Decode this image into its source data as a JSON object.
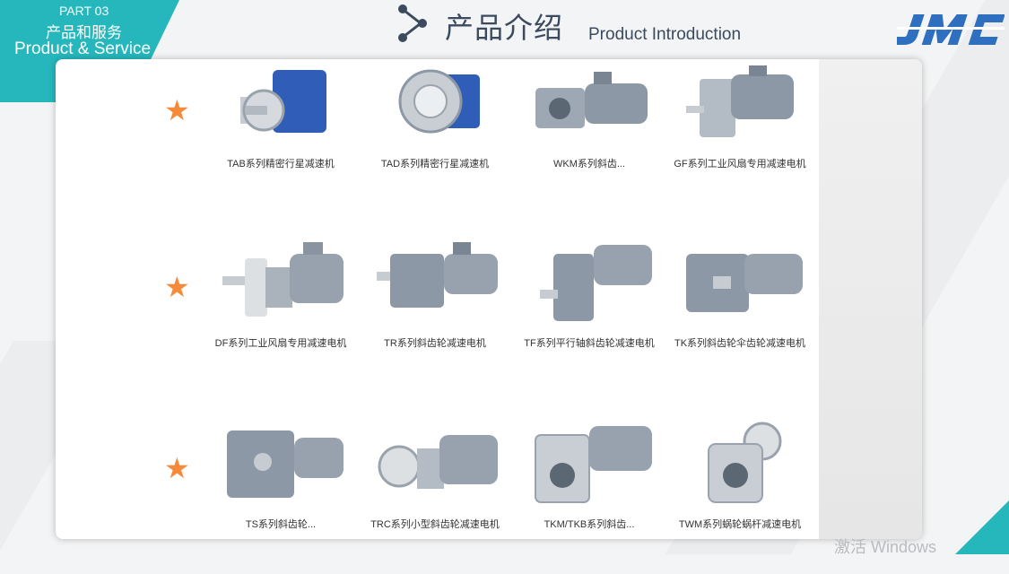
{
  "part": {
    "number": "PART 03",
    "title_cn": "产品和服务",
    "title_en": "Product & Service"
  },
  "header": {
    "title_cn": "产品介绍",
    "title_en": "Product Introduction"
  },
  "logo_text": "JMC",
  "products": [
    {
      "name": "TAB系列精密行星减速机"
    },
    {
      "name": "TAD系列精密行星减速机"
    },
    {
      "name": "WKM系列斜齿..."
    },
    {
      "name": "GF系列工业风扇专用减速电机"
    },
    {
      "name": "DF系列工业风扇专用减速电机"
    },
    {
      "name": "TR系列斜齿轮减速电机"
    },
    {
      "name": "TF系列平行轴斜齿轮减速电机"
    },
    {
      "name": "TK系列斜齿轮伞齿轮减速电机"
    },
    {
      "name": "TS系列斜齿轮..."
    },
    {
      "name": "TRC系列小型斜齿轮减速电机"
    },
    {
      "name": "TKM/TKB系列斜齿..."
    },
    {
      "name": "TWM系列蜗轮蜗杆减速电机"
    }
  ],
  "watermark": "激活 Windows",
  "colors": {
    "accent": "#26b7bd",
    "star": "#f58a3a",
    "title": "#3b4a5e",
    "gear_blue": "#2f5db8",
    "gear_gray": "#8d98a6"
  }
}
